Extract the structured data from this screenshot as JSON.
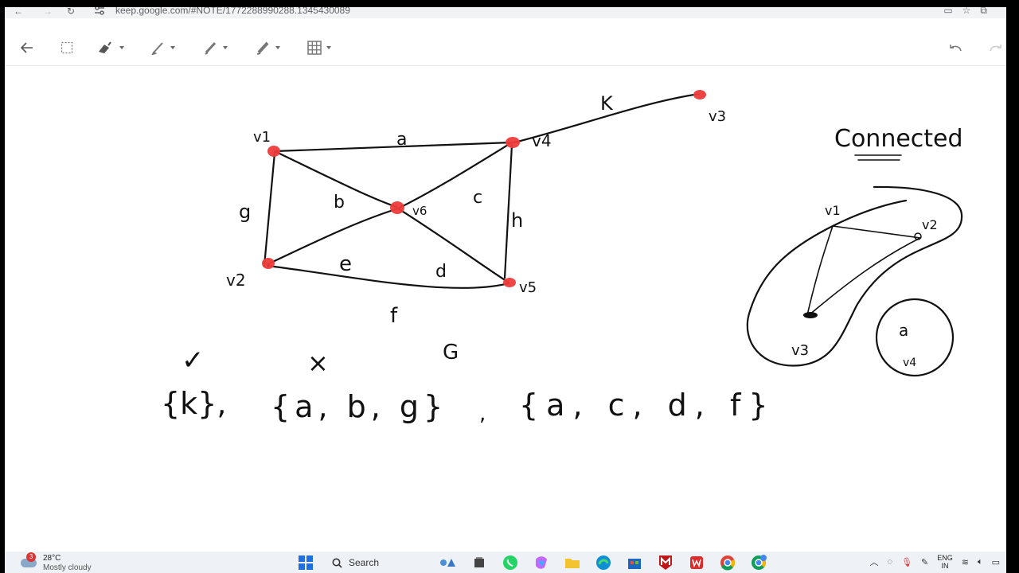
{
  "browser": {
    "url": "keep.google.com/#NOTE/1772288990288.1345430089",
    "nav_back_icon": "arrow-left-icon",
    "nav_forward_icon": "arrow-right-icon",
    "reload_icon": "reload-icon"
  },
  "toolbar": {
    "tools": [
      "back-icon",
      "lasso-select-icon",
      "eraser-icon",
      "pen-icon",
      "marker-icon",
      "highlighter-icon",
      "grid-icon"
    ],
    "undo_icon": "undo-icon",
    "redo_icon": "redo-icon"
  },
  "drawing": {
    "vertices": {
      "v1": "v1",
      "v2": "v2",
      "v3": "v3",
      "v4": "v4",
      "v5": "v5",
      "v6": "v6"
    },
    "edges": {
      "a": "a",
      "b": "b",
      "c": "c",
      "d": "d",
      "e": "e",
      "f": "f",
      "g": "g",
      "h": "h",
      "k": "K"
    },
    "graph_name": "G",
    "sets": [
      "{k},",
      "{a, b, g}",
      ",",
      "{a, c, d, f}"
    ],
    "check_mark": "✓",
    "cross_mark": "×",
    "side_title": "Connected",
    "side_vertices": {
      "v1": "v1",
      "v2": "v2",
      "v3": "v3",
      "v4": "v4"
    },
    "side_circle_label": "a"
  },
  "taskbar": {
    "weather_temp": "28°C",
    "weather_condition": "Mostly cloudy",
    "weather_badge": "3",
    "search_label": "Search",
    "lang_line1": "ENG",
    "lang_line2": "IN"
  },
  "colors": {
    "vertex": "#ee3b3b",
    "ink": "#111111",
    "windows_blue": "#1f6fe0"
  }
}
